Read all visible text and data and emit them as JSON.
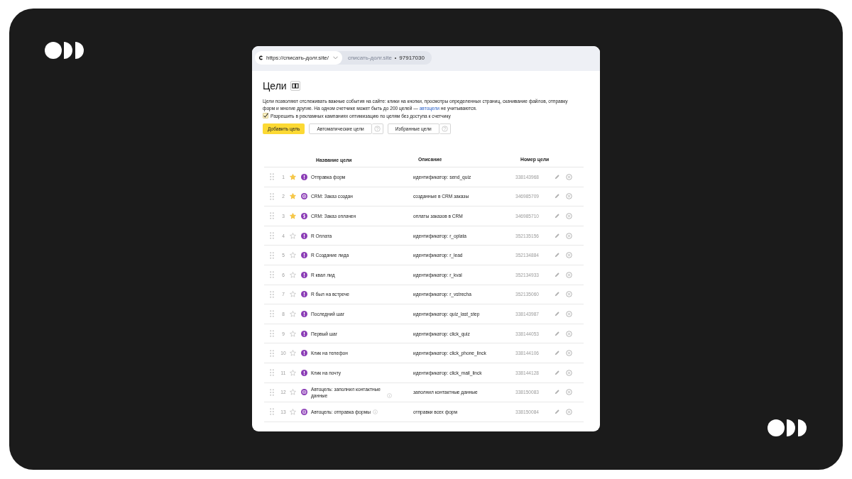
{
  "browser": {
    "url": "https://списать-долг.site/",
    "site": "списать-долг.site",
    "separator": "•",
    "counter": "97917030"
  },
  "page": {
    "title": "Цели",
    "intro": "Цели позволяют отслеживать важные события на сайте: клики на кнопки, просмотры определенных страниц, скачивание файлов, отправку форм и многие другие. На одном счетчике может быть до 200 целей — ",
    "intro_link": "автоцели",
    "intro_end": " не учитываются.",
    "checkbox": {
      "label": "Разрешить в рекламных кампаниях оптимизацию по целям без доступа к счетчику",
      "checked": true
    },
    "buttons": [
      {
        "label": "Добавить цель",
        "kind": "primary"
      },
      {
        "label": "Автоматические цели",
        "kind": "help"
      },
      {
        "label": "Избранные цели",
        "kind": "help"
      }
    ]
  },
  "table": {
    "columns": [
      "Название цели",
      "Описание",
      "Номер цели"
    ],
    "rows": [
      {
        "index": "1",
        "favorite": true,
        "kind": "event",
        "name": "Отправка форм",
        "info": false,
        "description": "идентификатор: send_quiz",
        "number": "338143968"
      },
      {
        "index": "2",
        "favorite": true,
        "kind": "crm",
        "name": "CRM: Заказ создан",
        "info": false,
        "description": "созданные в CRM заказы",
        "number": "346985709"
      },
      {
        "index": "3",
        "favorite": true,
        "kind": "money",
        "name": "CRM: Заказ оплачен",
        "info": false,
        "description": "оплаты заказов в CRM",
        "number": "346985710"
      },
      {
        "index": "4",
        "favorite": false,
        "kind": "event",
        "name": "R Оплата",
        "info": false,
        "description": "идентификатор: r_oplata",
        "number": "352135156"
      },
      {
        "index": "5",
        "favorite": false,
        "kind": "event",
        "name": "R Создание лида",
        "info": false,
        "description": "идентификатор: r_lead",
        "number": "352134884"
      },
      {
        "index": "6",
        "favorite": false,
        "kind": "event",
        "name": "R квал лид",
        "info": false,
        "description": "идентификатор: r_kval",
        "number": "352134933"
      },
      {
        "index": "7",
        "favorite": false,
        "kind": "event",
        "name": "R был на встрече",
        "info": false,
        "description": "идентификатор: r_vstrecha",
        "number": "352135060"
      },
      {
        "index": "8",
        "favorite": false,
        "kind": "event",
        "name": "Последний шаг",
        "info": false,
        "description": "идентификатор: quiz_last_step",
        "number": "338143987"
      },
      {
        "index": "9",
        "favorite": false,
        "kind": "event",
        "name": "Первый шаг",
        "info": false,
        "description": "идентификатор: click_quiz",
        "number": "338144053"
      },
      {
        "index": "10",
        "favorite": false,
        "kind": "event",
        "name": "Клик на телефон",
        "info": false,
        "description": "идентификатор: click_phone_linck",
        "number": "338144106"
      },
      {
        "index": "11",
        "favorite": false,
        "kind": "event",
        "name": "Клик на почту",
        "info": false,
        "description": "идентификатор: click_mail_linck",
        "number": "338144128"
      },
      {
        "index": "12",
        "favorite": false,
        "kind": "contact",
        "name": "Автоцель: заполнил контактные данные",
        "info": true,
        "description": "заполнил контактные данные",
        "number": "338150083"
      },
      {
        "index": "13",
        "favorite": false,
        "kind": "form",
        "name": "Автоцель: отправка формы",
        "info": true,
        "description": "отправки всех форм",
        "number": "338150084"
      }
    ]
  }
}
